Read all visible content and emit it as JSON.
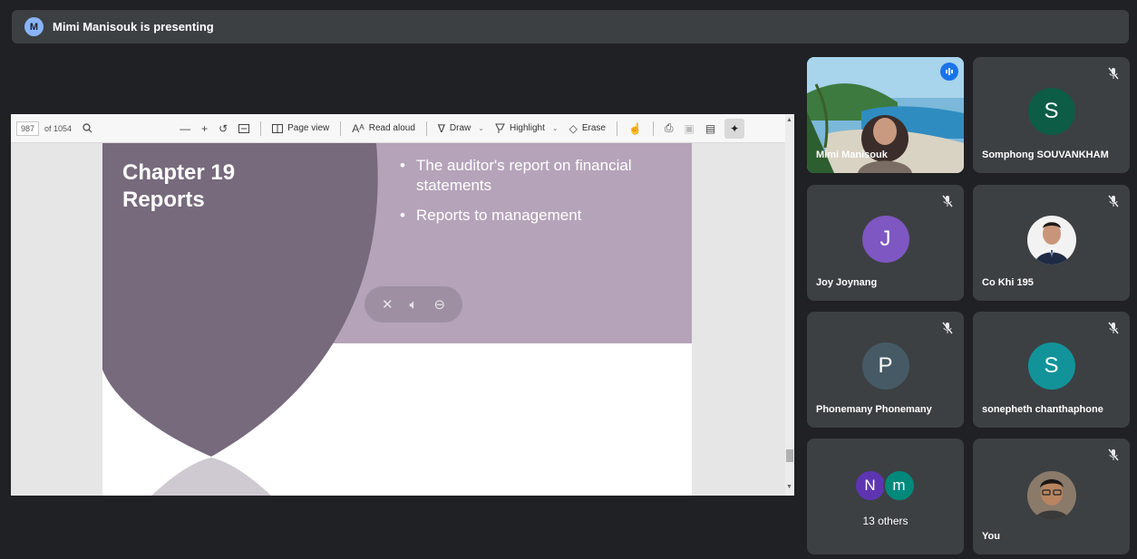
{
  "banner": {
    "avatar_initial": "M",
    "text": "Mimi Manisouk is presenting"
  },
  "pdf_toolbar": {
    "page_current": "987",
    "page_total": "of 1054",
    "page_view_label": "Page view",
    "read_aloud_label": "Read aloud",
    "draw_label": "Draw",
    "highlight_label": "Highlight",
    "erase_label": "Erase"
  },
  "slide": {
    "title_line1": "Chapter 19",
    "title_line2": "Reports",
    "bullets": [
      "The auditor's report on financial statements",
      "Reports to management"
    ],
    "colors": {
      "band": "#b5a3b9",
      "shield": "#776a7c"
    }
  },
  "participants": [
    {
      "name": "Mimi Manisouk",
      "type": "video",
      "speaking": true
    },
    {
      "name": "Somphong SOUVANKHAM",
      "initial": "S",
      "avatar_color": "#0d5c46",
      "muted": true
    },
    {
      "name": "Joy Joynang",
      "initial": "J",
      "avatar_color": "#7e57c2",
      "muted": true
    },
    {
      "name": "Co Khi 195",
      "type": "photo",
      "muted": true
    },
    {
      "name": "Phonemany Phonemany",
      "initial": "P",
      "avatar_color": "#455a64",
      "muted": true
    },
    {
      "name": "sonepheth chanthaphone",
      "initial": "S",
      "avatar_color": "#12939a",
      "muted": true
    },
    {
      "others_initials": [
        "N",
        "m"
      ],
      "others_colors": [
        "#5e35b1",
        "#00897b"
      ],
      "others_label": "13 others"
    },
    {
      "name": "You",
      "type": "photo",
      "muted": true
    }
  ]
}
